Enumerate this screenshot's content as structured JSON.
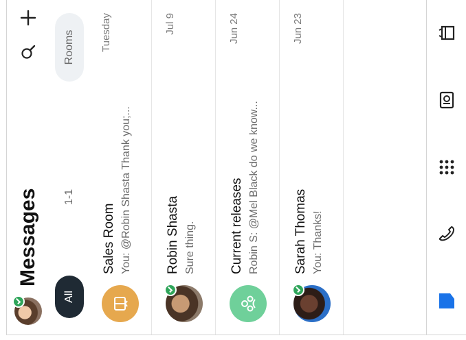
{
  "header": {
    "title": "Messages"
  },
  "tabs": [
    {
      "label": "All"
    },
    {
      "label": "1-1"
    },
    {
      "label": "Rooms"
    }
  ],
  "conversations": [
    {
      "name": "Sales Room",
      "preview": "You: @Robin Shasta Thank you;...",
      "date": "Tuesday",
      "avatar": "room-icon"
    },
    {
      "name": "Robin Shasta",
      "preview": "Sure thing.",
      "date": "Jul 9",
      "avatar": "photo"
    },
    {
      "name": "Current releases",
      "preview": "Robin S: @Mel Black do we know...",
      "date": "Jun 24",
      "avatar": "team-icon"
    },
    {
      "name": "Sarah Thomas",
      "preview": "You: Thanks!",
      "date": "Jun 23",
      "avatar": "photo"
    }
  ],
  "bottom_nav": [
    "messages-icon",
    "calls-icon",
    "apps-icon",
    "meetings-icon",
    "calendar-icon"
  ],
  "colors": {
    "accent": "#1a73e8",
    "presence": "#2fa55a",
    "active_tab": "#1f2a34",
    "sales_room": "#e6a84e",
    "releases": "#6fd09a"
  }
}
